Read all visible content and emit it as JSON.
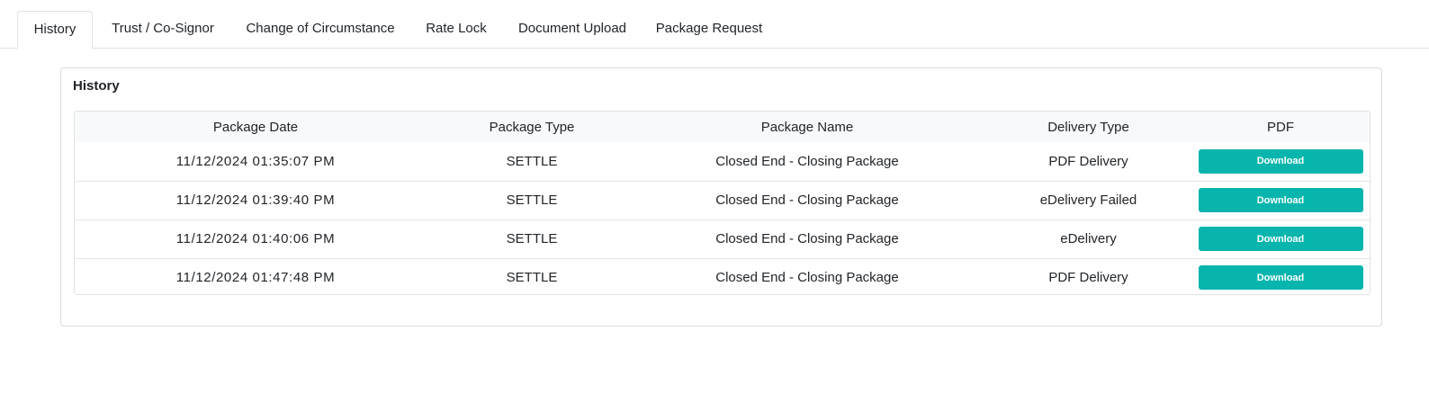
{
  "tabs": [
    {
      "label": "History",
      "active": true
    },
    {
      "label": "Trust / Co-Signor",
      "active": false
    },
    {
      "label": "Change of Circumstance",
      "active": false
    },
    {
      "label": "Rate Lock",
      "active": false
    },
    {
      "label": "Document Upload",
      "active": false
    },
    {
      "label": "Package Request",
      "active": false
    }
  ],
  "history": {
    "title": "History",
    "columns": [
      "Package Date",
      "Package Type",
      "Package Name",
      "Delivery Type",
      "PDF"
    ],
    "rows": [
      {
        "date": "11/12/2024 01:35:07 PM",
        "type": "SETTLE",
        "name": "Closed End - Closing Package",
        "delivery": "PDF Delivery",
        "action": "Download"
      },
      {
        "date": "11/12/2024 01:39:40 PM",
        "type": "SETTLE",
        "name": "Closed End - Closing Package",
        "delivery": "eDelivery Failed",
        "action": "Download"
      },
      {
        "date": "11/12/2024 01:40:06 PM",
        "type": "SETTLE",
        "name": "Closed End - Closing Package",
        "delivery": "eDelivery",
        "action": "Download"
      },
      {
        "date": "11/12/2024 01:47:48 PM",
        "type": "SETTLE",
        "name": "Closed End - Closing Package",
        "delivery": "PDF Delivery",
        "action": "Download"
      }
    ]
  },
  "colors": {
    "accent": "#07b5ad",
    "header_bg": "#f8f9fa",
    "border": "#dee2e6"
  }
}
